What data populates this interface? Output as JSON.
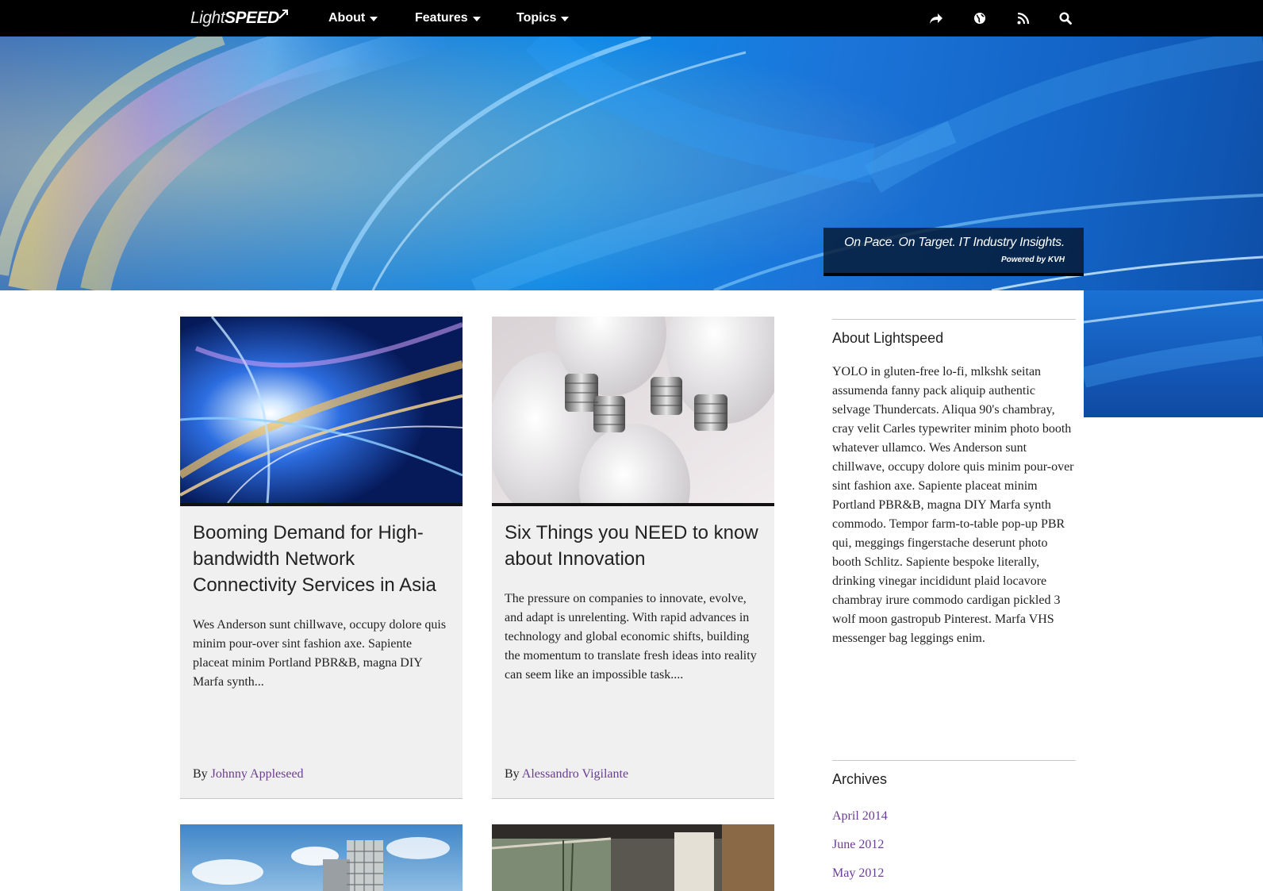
{
  "brand": {
    "logo_light": "Light",
    "logo_speed": "SPEED"
  },
  "nav": {
    "items": [
      {
        "label": "About"
      },
      {
        "label": "Features"
      },
      {
        "label": "Topics"
      }
    ],
    "icons": [
      "share-icon",
      "globe-icon",
      "rss-icon",
      "search-icon"
    ]
  },
  "hero": {
    "tagline": "On Pace. On Target. IT Industry Insights.",
    "powered_by": "Powered by KVH"
  },
  "posts": [
    {
      "title": "Booming Demand for High-bandwidth Network Connectivity Services in Asia",
      "excerpt": "Wes Anderson sunt chillwave, occupy dolore quis minim pour-over sint fashion axe. Sapiente placeat minim Portland PBR&B, magna DIY Marfa synth...",
      "by": "By",
      "author": "Johnny Appleseed"
    },
    {
      "title": "Six Things you NEED to know about Innovation",
      "excerpt": "The pressure on companies to innovate, evolve, and adapt is unrelenting. With rapid advances in technology and global economic shifts, building the momentum to translate fresh ideas into reality can seem like an impossible task....",
      "by": "By",
      "author": "Alessandro Vigilante"
    }
  ],
  "sidebar": {
    "about": {
      "title": "About Lightspeed",
      "body": "YOLO in gluten-free lo-fi, mlkshk seitan assumenda fanny pack aliquip authentic selvage Thundercats. Aliqua 90's chambray, cray velit Carles typewriter minim photo booth whatever ullamco. Wes Anderson sunt chillwave, occupy dolore quis minim pour-over sint fashion axe. Sapiente placeat minim Portland PBR&B, magna DIY Marfa synth commodo. Tempor farm-to-table pop-up PBR qui, meggings fingerstache deserunt photo booth Schlitz. Sapiente bespoke literally, drinking vinegar incididunt plaid locavore chambray irure commodo cardigan pickled 3 wolf moon gastropub Pinterest. Marfa VHS messenger bag leggings enim."
    },
    "archives": {
      "title": "Archives",
      "items": [
        "April 2014",
        "June 2012",
        "May 2012"
      ]
    }
  },
  "colors": {
    "nav_bg": "#000000",
    "link": "#6a3d8e",
    "card_bg": "#f0f0f0",
    "hero_blue": "#0f8ae8"
  }
}
